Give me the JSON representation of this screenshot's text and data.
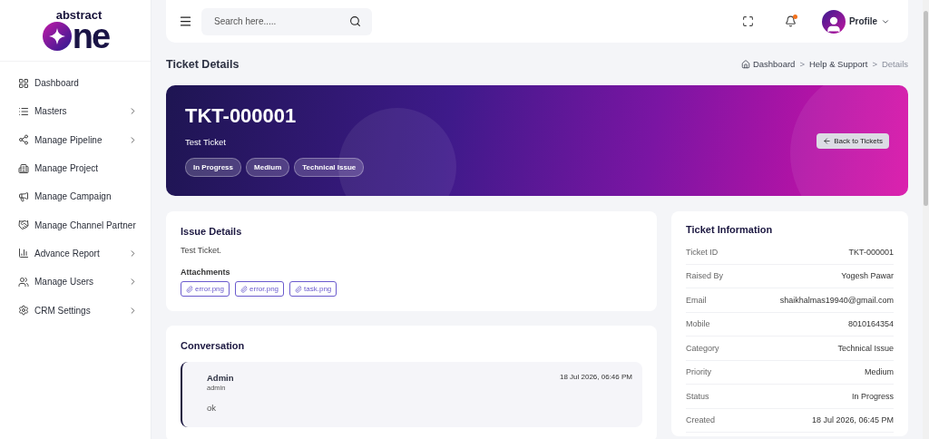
{
  "logo": {
    "top": "abstract",
    "main": "ne"
  },
  "sidebar": {
    "items": [
      {
        "label": "Dashboard",
        "expandable": false
      },
      {
        "label": "Masters",
        "expandable": true
      },
      {
        "label": "Manage Pipeline",
        "expandable": true
      },
      {
        "label": "Manage Project",
        "expandable": false
      },
      {
        "label": "Manage Campaign",
        "expandable": false
      },
      {
        "label": "Manage Channel Partner",
        "expandable": false
      },
      {
        "label": "Advance Report",
        "expandable": true
      },
      {
        "label": "Manage Users",
        "expandable": true
      },
      {
        "label": "CRM Settings",
        "expandable": true
      }
    ]
  },
  "topbar": {
    "search": {
      "placeholder": "Search here....."
    },
    "notification": true,
    "profile": "Profile"
  },
  "page": {
    "title": "Ticket Details",
    "breadcrumb": [
      {
        "label": "Dashboard",
        "current": false
      },
      {
        "label": "Help & Support",
        "current": false
      },
      {
        "label": "Details",
        "current": true
      }
    ],
    "separator": ">"
  },
  "hero": {
    "ticket_id": "TKT-000001",
    "subject": "Test Ticket",
    "badges": [
      "In Progress",
      "Medium",
      "Technical Issue"
    ],
    "back_button": "Back to Tickets"
  },
  "issue": {
    "title": "Issue Details",
    "description": "Test Ticket.",
    "attachments_label": "Attachments",
    "attachments": [
      "error.png",
      "error.png",
      "task.png"
    ]
  },
  "conversation": {
    "title": "Conversation",
    "messages": [
      {
        "author": "Admin",
        "role": "admin",
        "time": "18 Jul 2026, 06:46 PM",
        "text": "ok"
      }
    ]
  },
  "info": {
    "title": "Ticket Information",
    "rows": [
      {
        "label": "Ticket ID",
        "value": "TKT-000001"
      },
      {
        "label": "Raised By",
        "value": "Yogesh Pawar"
      },
      {
        "label": "Email",
        "value": "shaikhalmas19940@gmail.com"
      },
      {
        "label": "Mobile",
        "value": "8010164354"
      },
      {
        "label": "Category",
        "value": "Technical Issue"
      },
      {
        "label": "Priority",
        "value": "Medium"
      },
      {
        "label": "Status",
        "value": "In Progress"
      },
      {
        "label": "Created",
        "value": "18 Jul 2026, 06:45 PM"
      }
    ]
  }
}
